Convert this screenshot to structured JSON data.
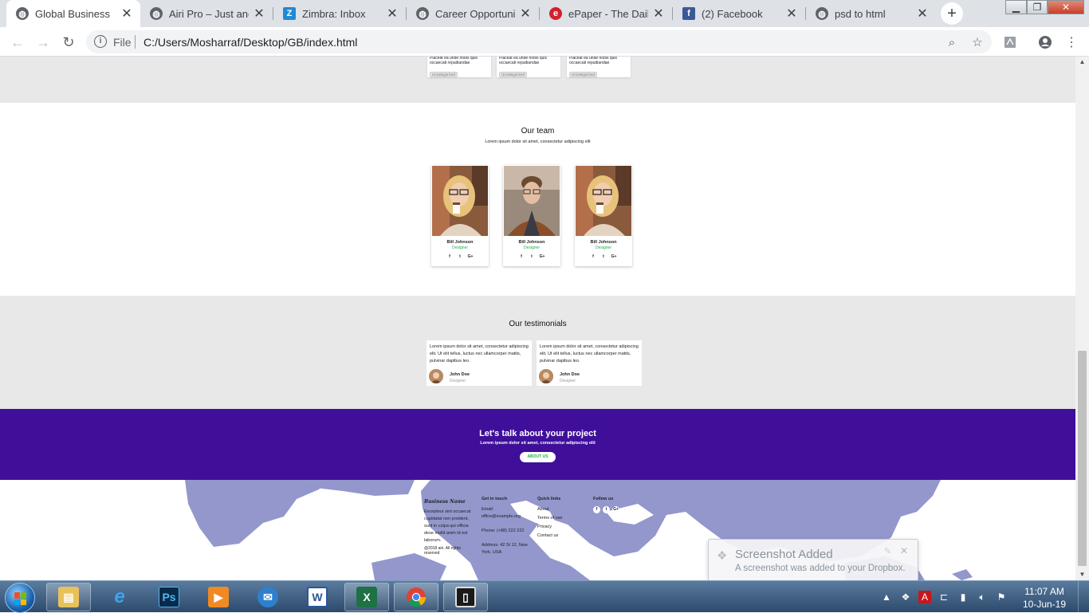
{
  "browser": {
    "tabs": [
      {
        "title": "Global Business",
        "favicon": "globe-icon",
        "active": true
      },
      {
        "title": "Airi Pro – Just anoth",
        "favicon": "globe-icon",
        "active": false
      },
      {
        "title": "Zimbra: Inbox",
        "favicon": "zimbra-icon",
        "active": false
      },
      {
        "title": "Career Opportunity",
        "favicon": "globe-icon",
        "active": false
      },
      {
        "title": "ePaper - The Daily",
        "favicon": "epaper-icon",
        "active": false
      },
      {
        "title": "(2) Facebook",
        "favicon": "facebook-icon",
        "active": false
      },
      {
        "title": "psd to html",
        "favicon": "globe-icon",
        "active": false
      }
    ],
    "address": {
      "scheme_label": "File",
      "url": "C:/Users/Mosharraf/Desktop/GB/index.html"
    }
  },
  "page": {
    "blog": {
      "cards": [
        {
          "excerpt": "Placeat ea unde nobis quis occaecati repudiandae",
          "tag": "Uncategorized"
        },
        {
          "excerpt": "Placeat ea unde nobis quis occaecati repudiandae",
          "tag": "Uncategorized"
        },
        {
          "excerpt": "Placeat ea unde nobis quis occaecati repudiandae",
          "tag": "Uncategorized"
        }
      ]
    },
    "team": {
      "title": "Our team",
      "subtitle": "Lorem ipsum dolor sit amet, consectetur adipiscing elit",
      "members": [
        {
          "name": "Bill Johnson",
          "role": "Designer",
          "photo": "woman-with-coffee"
        },
        {
          "name": "Bill Johnson",
          "role": "Designer",
          "photo": "man-in-jacket"
        },
        {
          "name": "Bill Johnson",
          "role": "Designer",
          "photo": "woman-with-coffee"
        }
      ],
      "social": [
        "f",
        "t",
        "G+"
      ]
    },
    "testimonials": {
      "title": "Our testimonials",
      "items": [
        {
          "quote": "Lorem ipsum dolor sit amet, consectetur adipiscing elit. Ut elit tellus, luctus nec ullamcorper mattis, pulvinar dapibus leo.",
          "name": "John Doe",
          "role": "Designer"
        },
        {
          "quote": "Lorem ipsum dolor sit amet, consectetur adipiscing elit. Ut elit tellus, luctus nec ullamcorper mattis, pulvinar dapibus leo.",
          "name": "John Doe",
          "role": "Designer"
        }
      ]
    },
    "cta": {
      "title": "Let's talk about your project",
      "subtitle": "Lorem ipsum dolor sit amet, consectetur adipiscing elit",
      "button": "ABOUT US",
      "background": "#3f0f9a"
    },
    "footer": {
      "brand": "Business Name",
      "about": "Excepteur sint occaecat cupidatat non proident, sunt in culpa qui officia dese mollit anim id est laborum.",
      "copyright": "@2018 airi. All rights reserved",
      "contact": {
        "heading": "Get in touch",
        "email_label": "Email:",
        "email": "office@example.org",
        "phone": "Phone: (+88) 222 222",
        "address": "Address: 42 St 12, New York, USA"
      },
      "quick_links": {
        "heading": "Quick links",
        "items": [
          "About",
          "Terms of use",
          "Privacy",
          "Contact us"
        ]
      },
      "follow": {
        "heading": "Follow us",
        "items": [
          "f",
          "t",
          "G+"
        ]
      }
    }
  },
  "toast": {
    "title": "Screenshot Added",
    "body": "A screenshot was added to your Dropbox."
  },
  "taskbar": {
    "apps": [
      "windows-explorer",
      "internet-explorer",
      "photoshop",
      "media-player",
      "outlook",
      "word",
      "excel",
      "chrome",
      "app-window"
    ],
    "clock": {
      "time": "11:07 AM",
      "date": "10-Jun-19"
    }
  }
}
